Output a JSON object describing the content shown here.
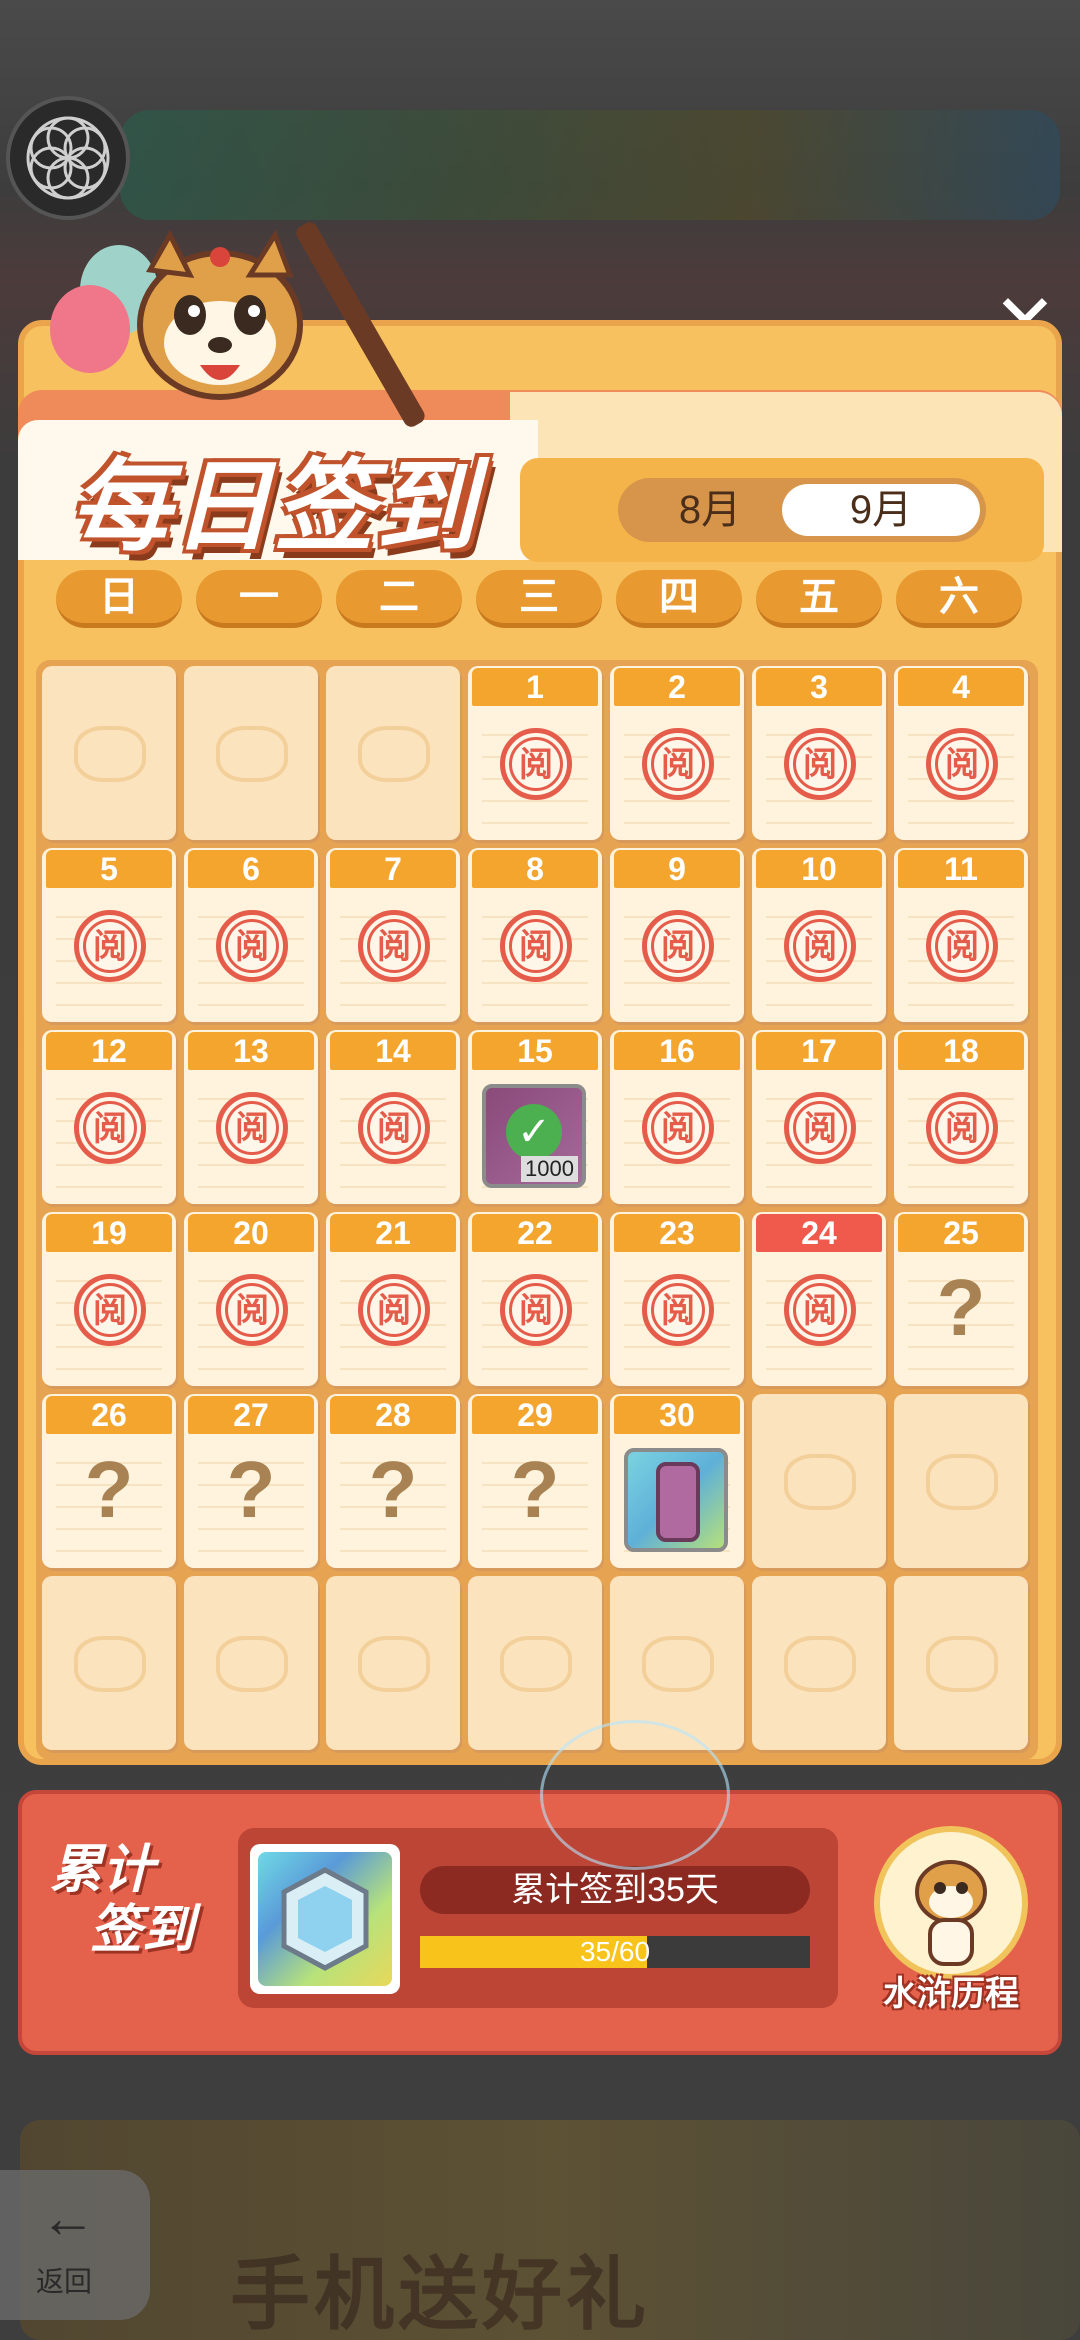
{
  "header": {
    "title": "每日签到",
    "close_icon": "close-icon"
  },
  "months": {
    "tabs": [
      {
        "label": "8月",
        "selected": false
      },
      {
        "label": "9月",
        "selected": true
      }
    ]
  },
  "weekdays": [
    "日",
    "一",
    "二",
    "三",
    "四",
    "五",
    "六"
  ],
  "calendar": {
    "stamp_text": "阅",
    "unknown_text": "?",
    "today": "24",
    "rows": [
      [
        {
          "day": "",
          "state": "empty"
        },
        {
          "day": "",
          "state": "empty"
        },
        {
          "day": "",
          "state": "empty"
        },
        {
          "day": "1",
          "state": "signed"
        },
        {
          "day": "2",
          "state": "signed"
        },
        {
          "day": "3",
          "state": "signed"
        },
        {
          "day": "4",
          "state": "signed"
        }
      ],
      [
        {
          "day": "5",
          "state": "signed"
        },
        {
          "day": "6",
          "state": "signed"
        },
        {
          "day": "7",
          "state": "signed"
        },
        {
          "day": "8",
          "state": "signed"
        },
        {
          "day": "9",
          "state": "signed"
        },
        {
          "day": "10",
          "state": "signed"
        },
        {
          "day": "11",
          "state": "signed"
        }
      ],
      [
        {
          "day": "12",
          "state": "signed"
        },
        {
          "day": "13",
          "state": "signed"
        },
        {
          "day": "14",
          "state": "signed"
        },
        {
          "day": "15",
          "state": "reward-claimed",
          "reward_count": "1000"
        },
        {
          "day": "16",
          "state": "signed"
        },
        {
          "day": "17",
          "state": "signed"
        },
        {
          "day": "18",
          "state": "signed"
        }
      ],
      [
        {
          "day": "19",
          "state": "signed"
        },
        {
          "day": "20",
          "state": "signed"
        },
        {
          "day": "21",
          "state": "signed"
        },
        {
          "day": "22",
          "state": "signed"
        },
        {
          "day": "23",
          "state": "signed"
        },
        {
          "day": "24",
          "state": "signed"
        },
        {
          "day": "25",
          "state": "unknown"
        }
      ],
      [
        {
          "day": "26",
          "state": "unknown"
        },
        {
          "day": "27",
          "state": "unknown"
        },
        {
          "day": "28",
          "state": "unknown"
        },
        {
          "day": "29",
          "state": "unknown"
        },
        {
          "day": "30",
          "state": "reward"
        },
        {
          "day": "",
          "state": "empty"
        },
        {
          "day": "",
          "state": "empty"
        }
      ],
      [
        {
          "day": "",
          "state": "empty"
        },
        {
          "day": "",
          "state": "empty"
        },
        {
          "day": "",
          "state": "empty"
        },
        {
          "day": "",
          "state": "empty"
        },
        {
          "day": "",
          "state": "empty"
        },
        {
          "day": "",
          "state": "empty"
        },
        {
          "day": "",
          "state": "empty"
        }
      ]
    ]
  },
  "cumulative": {
    "label_line1": "累计",
    "label_line2": "签到",
    "title": "累计签到35天",
    "progress_text": "35/60",
    "progress_fraction": 0.583,
    "history_label": "水浒历程"
  },
  "background": {
    "back_arrow": "←",
    "back_text": "返回",
    "banner_text": "手机送好礼"
  },
  "colors": {
    "stamp": "#e55c4a",
    "progress_fill": "#f8c41c",
    "today_header": "#ef5a4c",
    "cell_header": "#f4a52e"
  }
}
